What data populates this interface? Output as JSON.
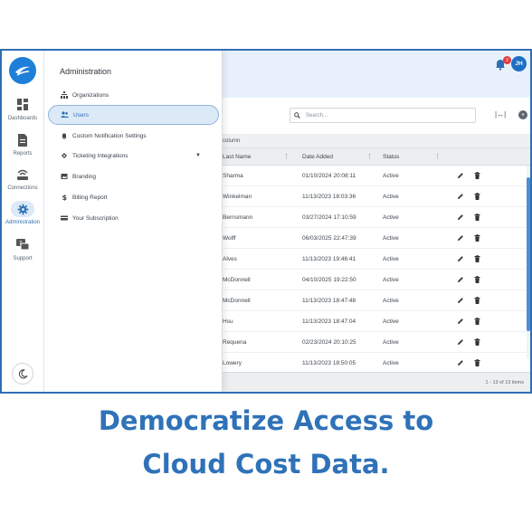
{
  "nav_rail": {
    "items": [
      {
        "label": "Dashboards",
        "icon": "dashboard-icon"
      },
      {
        "label": "Reports",
        "icon": "report-icon"
      },
      {
        "label": "Connections",
        "icon": "router-icon"
      },
      {
        "label": "Administration",
        "icon": "gear-icon"
      },
      {
        "label": "Support",
        "icon": "support-icon"
      }
    ]
  },
  "drawer": {
    "title": "Administration",
    "items": [
      {
        "label": "Organizations",
        "icon": "org-icon"
      },
      {
        "label": "Users",
        "icon": "users-icon"
      },
      {
        "label": "Custom Notification Settings",
        "icon": "bell-icon"
      },
      {
        "label": "Ticketing Integrations",
        "icon": "ticket-icon"
      },
      {
        "label": "Branding",
        "icon": "branding-icon"
      },
      {
        "label": "Billing Report",
        "icon": "dollar-icon"
      },
      {
        "label": "Your Subscription",
        "icon": "card-icon"
      }
    ]
  },
  "header": {
    "notification_count": "2",
    "avatar_initials": "JH"
  },
  "search": {
    "placeholder": "Search..."
  },
  "toolbar": {
    "expand_label": "|↔|",
    "more_label": "+"
  },
  "grid": {
    "group_hint": "column",
    "columns": [
      "Last Name",
      "Date Added",
      "Status"
    ],
    "rows": [
      {
        "last_name": "Sharma",
        "date_added": "01/10/2024 20:08:11",
        "status": "Active"
      },
      {
        "last_name": "Winkelman",
        "date_added": "11/13/2023 18:03:36",
        "status": "Active"
      },
      {
        "last_name": "Bernsmann",
        "date_added": "03/27/2024 17:10:59",
        "status": "Active"
      },
      {
        "last_name": "Wolff",
        "date_added": "06/03/2025 22:47:39",
        "status": "Active"
      },
      {
        "last_name": "Alves",
        "date_added": "11/13/2023 19:46:41",
        "status": "Active"
      },
      {
        "last_name": "McDonnell",
        "date_added": "04/10/2025 19:22:50",
        "status": "Active"
      },
      {
        "last_name": "McDonnell",
        "date_added": "11/13/2023 18:47:48",
        "status": "Active"
      },
      {
        "last_name": "Hsu",
        "date_added": "11/13/2023 18:47:04",
        "status": "Active"
      },
      {
        "last_name": "Requena",
        "date_added": "02/23/2024 20:10:25",
        "status": "Active"
      },
      {
        "last_name": "Lowery",
        "date_added": "11/13/2023 18:50:05",
        "status": "Active"
      }
    ],
    "footer": "1 - 13 of 13 items"
  },
  "headline": {
    "line1": "Democratize Access to",
    "line2": "Cloud Cost Data."
  },
  "colors": {
    "accent": "#2f72b8",
    "active_bg": "#dce9f7",
    "badge": "#e23b3b"
  }
}
